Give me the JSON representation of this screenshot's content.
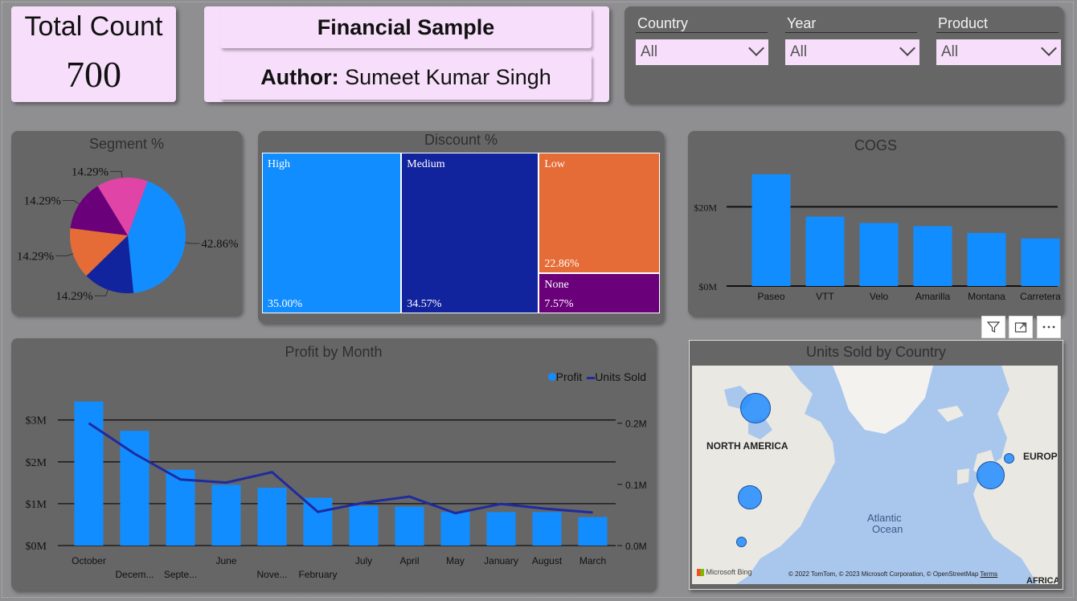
{
  "kpi": {
    "label": "Total Count",
    "value": "700"
  },
  "title_card": {
    "title": "Financial Sample",
    "author_label": "Author:",
    "author_name": " Sumeet Kumar Singh"
  },
  "slicers": [
    {
      "label": "Country",
      "value": "All"
    },
    {
      "label": "Year",
      "value": "All"
    },
    {
      "label": "Product",
      "value": "All"
    }
  ],
  "colors": {
    "blue": "#118dff",
    "navy": "#12239e",
    "orange": "#e66c37",
    "purple": "#6b007b",
    "pink": "#e044a7",
    "line": "#1f2b9e"
  },
  "segment_chart": {
    "title": "Segment %",
    "chart_data": {
      "type": "pie",
      "title": "Segment %",
      "slices": [
        {
          "value": 42.86,
          "label": "42.86%",
          "color": "#118dff"
        },
        {
          "value": 14.29,
          "label": "14.29%",
          "color": "#12239e"
        },
        {
          "value": 14.29,
          "label": "14.29%",
          "color": "#e66c37"
        },
        {
          "value": 14.29,
          "label": "14.29%",
          "color": "#6b007b"
        },
        {
          "value": 14.29,
          "label": "14.29%",
          "color": "#e044a7"
        }
      ]
    }
  },
  "discount_chart": {
    "title": "Discount %",
    "chart_data": {
      "type": "treemap",
      "title": "Discount %",
      "items": [
        {
          "name": "High",
          "value": 35.0,
          "label": "35.00%",
          "color": "#118dff"
        },
        {
          "name": "Medium",
          "value": 34.57,
          "label": "34.57%",
          "color": "#12239e"
        },
        {
          "name": "Low",
          "value": 22.86,
          "label": "22.86%",
          "color": "#e66c37"
        },
        {
          "name": "None",
          "value": 7.57,
          "label": "7.57%",
          "color": "#6b007b"
        }
      ]
    }
  },
  "cogs_chart": {
    "title": "COGS",
    "chart_data": {
      "type": "bar",
      "title": "COGS",
      "categories": [
        "Paseo",
        "VTT",
        "Velo",
        "Amarilla",
        "Montana",
        "Carretera"
      ],
      "values": [
        28.2,
        17.5,
        15.9,
        15.1,
        13.4,
        12.0
      ],
      "unit": "M",
      "ylim": [
        0,
        30
      ],
      "yticks": [
        {
          "value": 0,
          "label": "$0M"
        },
        {
          "value": 20,
          "label": "$20M"
        }
      ]
    }
  },
  "profit_chart": {
    "title": "Profit by Month",
    "legend": [
      {
        "name": "Profit",
        "kind": "dot"
      },
      {
        "name": "Units Sold",
        "kind": "line"
      }
    ],
    "chart_data": {
      "type": "bar",
      "title": "Profit by Month",
      "categories": [
        "October",
        "Decem...",
        "Septe...",
        "June",
        "Nove...",
        "February",
        "July",
        "April",
        "May",
        "January",
        "August",
        "March"
      ],
      "series": [
        {
          "name": "Profit",
          "axis": "left",
          "values": [
            3.44,
            2.74,
            1.81,
            1.45,
            1.38,
            1.14,
            0.95,
            0.93,
            0.8,
            0.8,
            0.8,
            0.68
          ]
        },
        {
          "name": "Units Sold",
          "axis": "right",
          "values": [
            0.2,
            0.15,
            0.108,
            0.103,
            0.12,
            0.055,
            0.07,
            0.08,
            0.053,
            0.068,
            0.06,
            0.054
          ]
        }
      ],
      "left_ylim": [
        0,
        3.8
      ],
      "right_ylim": [
        0,
        0.26
      ],
      "left_ticks": [
        {
          "value": 0,
          "label": "$0M"
        },
        {
          "value": 1,
          "label": "$1M"
        },
        {
          "value": 2,
          "label": "$2M"
        },
        {
          "value": 3,
          "label": "$3M"
        }
      ],
      "right_ticks": [
        {
          "value": 0,
          "label": "0.0M"
        },
        {
          "value": 0.1,
          "label": "0.1M"
        },
        {
          "value": 0.2,
          "label": "0.2M"
        }
      ]
    }
  },
  "units_map": {
    "title": "Units Sold by Country",
    "labels": {
      "na": "NORTH AMERICA",
      "eu": "EUROPE",
      "ocean1": "Atlantic",
      "ocean2": "Ocean",
      "africa": "AFRICA"
    },
    "attribution": "Microsoft Bing",
    "copyright": "© 2022 TomTom, © 2023 Microsoft Corporation, © OpenStreetMap",
    "terms": "Terms"
  }
}
